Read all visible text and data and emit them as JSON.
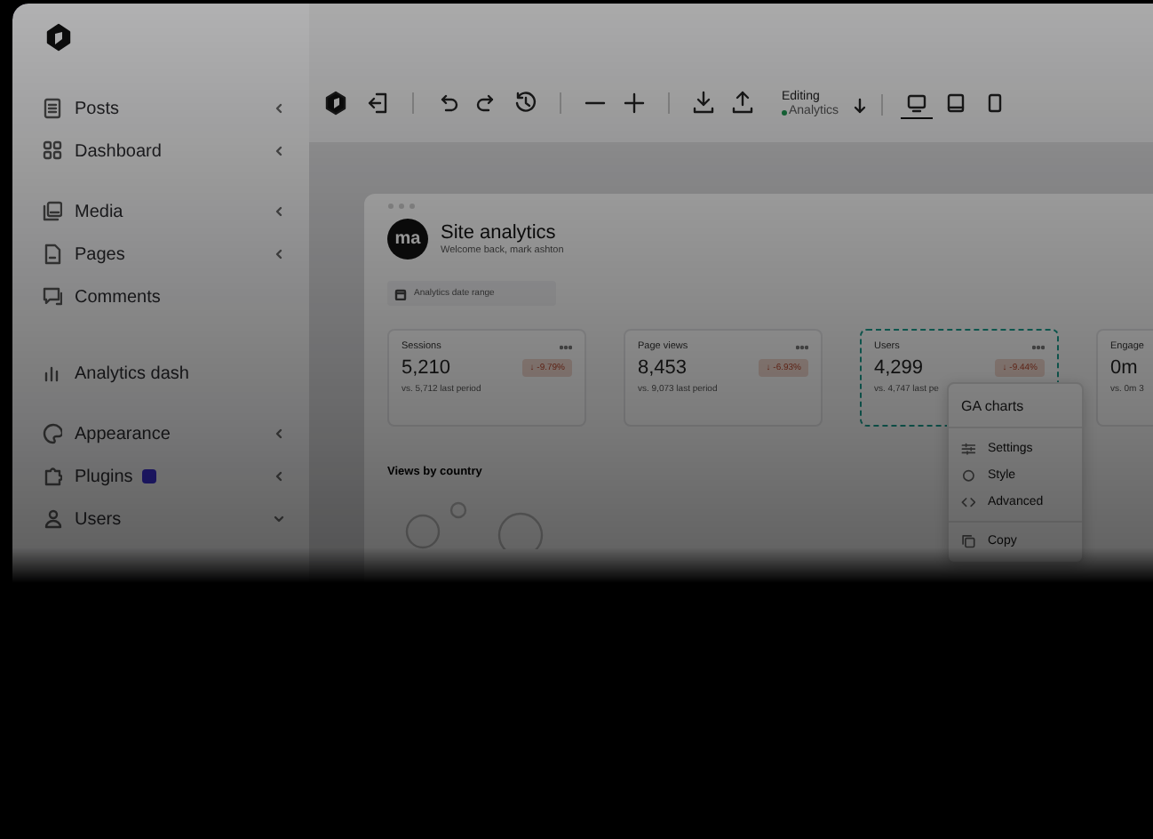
{
  "sidebar": {
    "sections": [
      {
        "items": [
          {
            "label": "Posts",
            "kind": "submenu",
            "expanded": false,
            "badge": false
          },
          {
            "label": "Dashboard",
            "kind": "submenu",
            "expanded": false,
            "badge": false
          }
        ]
      },
      {
        "items": [
          {
            "label": "Media",
            "kind": "submenu",
            "expanded": false,
            "badge": false
          },
          {
            "label": "Pages",
            "kind": "submenu",
            "expanded": false,
            "badge": false
          },
          {
            "label": "Comments",
            "kind": "link",
            "badge": false
          }
        ]
      },
      {
        "items": [
          {
            "label": "Analytics dash",
            "kind": "link",
            "badge": false
          }
        ]
      },
      {
        "items": [
          {
            "label": "Appearance",
            "kind": "submenu",
            "expanded": false,
            "badge": false
          },
          {
            "label": "Plugins",
            "kind": "submenu",
            "expanded": false,
            "badge": true
          },
          {
            "label": "Users",
            "kind": "submenu",
            "expanded": true,
            "badge": false
          }
        ]
      }
    ]
  },
  "toolbar": {
    "status": {
      "label": "Editing",
      "page": "Analytics"
    },
    "devices": [
      {
        "kind": "desktop",
        "selected": true
      },
      {
        "kind": "tablet",
        "selected": false
      },
      {
        "kind": "mobile",
        "selected": false
      }
    ]
  },
  "dashboard": {
    "avatar": "ma",
    "title": "Site analytics",
    "subtitle": "Welcome back, mark ashton",
    "date_range": {
      "placeholder": "Analytics date range"
    },
    "stats": [
      {
        "label": "Sessions",
        "value": "5,210",
        "change": "↓ -9.79%",
        "comparison": "vs. 5,712 last period",
        "selected": false
      },
      {
        "label": "Page views",
        "value": "8,453",
        "change": "↓ -6.93%",
        "comparison": "vs. 9,073 last period",
        "selected": false
      },
      {
        "label": "Users",
        "value": "4,299",
        "change": "↓ -9.44%",
        "comparison": "vs. 4,747 last pe",
        "selected": true
      },
      {
        "label": "Engage",
        "value": "0m",
        "comparison": "vs. 0m 3",
        "selected": false
      }
    ],
    "section_title": "Views by country"
  },
  "context_menu": {
    "title": "GA charts",
    "items": [
      {
        "label": "Settings"
      },
      {
        "label": "Style"
      },
      {
        "label": "Advanced"
      },
      {
        "label": "Copy"
      }
    ]
  }
}
